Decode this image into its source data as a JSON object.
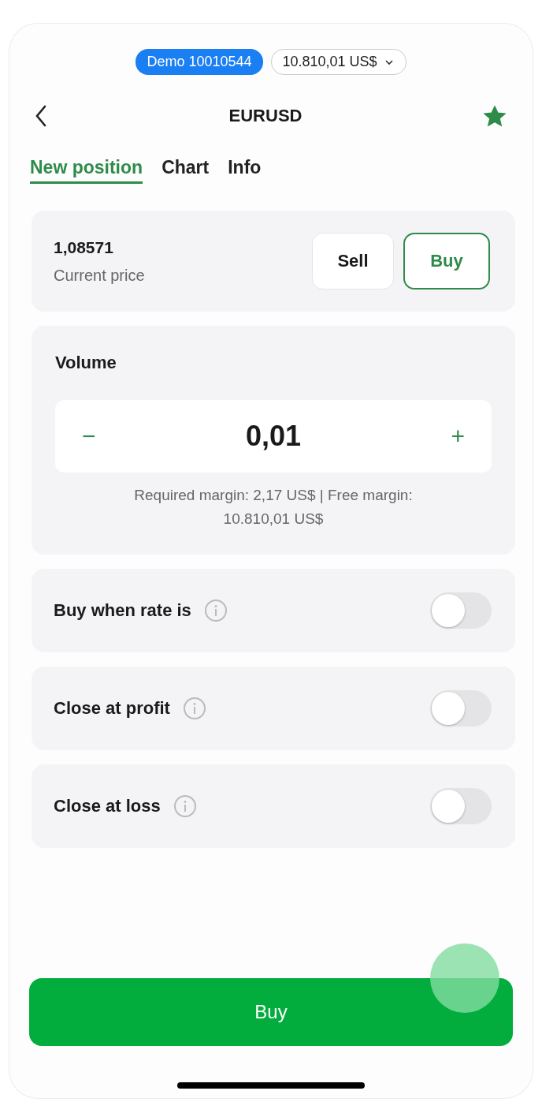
{
  "account": {
    "badge": "Demo 10010544",
    "balance": "10.810,01 US$"
  },
  "header": {
    "title": "EURUSD",
    "favorite": true
  },
  "tabs": [
    {
      "label": "New position",
      "selected": true
    },
    {
      "label": "Chart",
      "selected": false
    },
    {
      "label": "Info",
      "selected": false
    }
  ],
  "price": {
    "value": "1,08571",
    "label": "Current price"
  },
  "sides": [
    {
      "label": "Sell",
      "selected": false
    },
    {
      "label": "Buy",
      "selected": true
    }
  ],
  "volume": {
    "label": "Volume",
    "decrement": "−",
    "value": "0,01",
    "increment": "+",
    "margin_note": "Required margin: 2,17 US$ | Free margin: 10.810,01 US$"
  },
  "options": [
    {
      "label": "Buy when rate is",
      "on": false
    },
    {
      "label": "Close at profit",
      "on": false
    },
    {
      "label": "Close at loss",
      "on": false
    }
  ],
  "submit": {
    "label": "Buy"
  }
}
